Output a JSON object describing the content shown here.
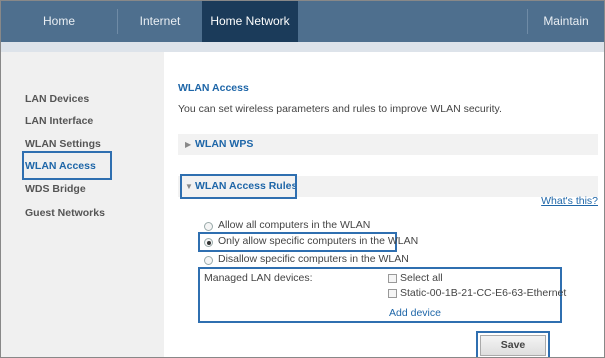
{
  "topnav": {
    "tabs": [
      {
        "label": "Home"
      },
      {
        "label": "Internet"
      },
      {
        "label": "Home Network"
      },
      {
        "label": "Maintain"
      }
    ],
    "active": "Home Network"
  },
  "sidebar": {
    "items": [
      {
        "label": "LAN Devices"
      },
      {
        "label": "LAN Interface"
      },
      {
        "label": "WLAN Settings"
      },
      {
        "label": "WLAN Access"
      },
      {
        "label": "WDS Bridge"
      },
      {
        "label": "Guest Networks"
      }
    ],
    "selected": "WLAN Access"
  },
  "main": {
    "title": "WLAN Access",
    "description": "You can set wireless parameters and rules to improve WLAN security.",
    "wps_section": "WLAN WPS",
    "rules_section": "WLAN Access Rules",
    "whats_this": "What's this?",
    "options": [
      {
        "label": "Allow all computers in the WLAN",
        "checked": false
      },
      {
        "label": "Only allow specific computers in the WLAN",
        "checked": true
      },
      {
        "label": "Disallow specific computers in the WLAN",
        "checked": false
      }
    ],
    "managed_label": "Managed LAN devices:",
    "select_all": "Select all",
    "device": "Static-00-1B-21-CC-E6-63-Ethernet",
    "add_device": "Add device",
    "save": "Save"
  }
}
